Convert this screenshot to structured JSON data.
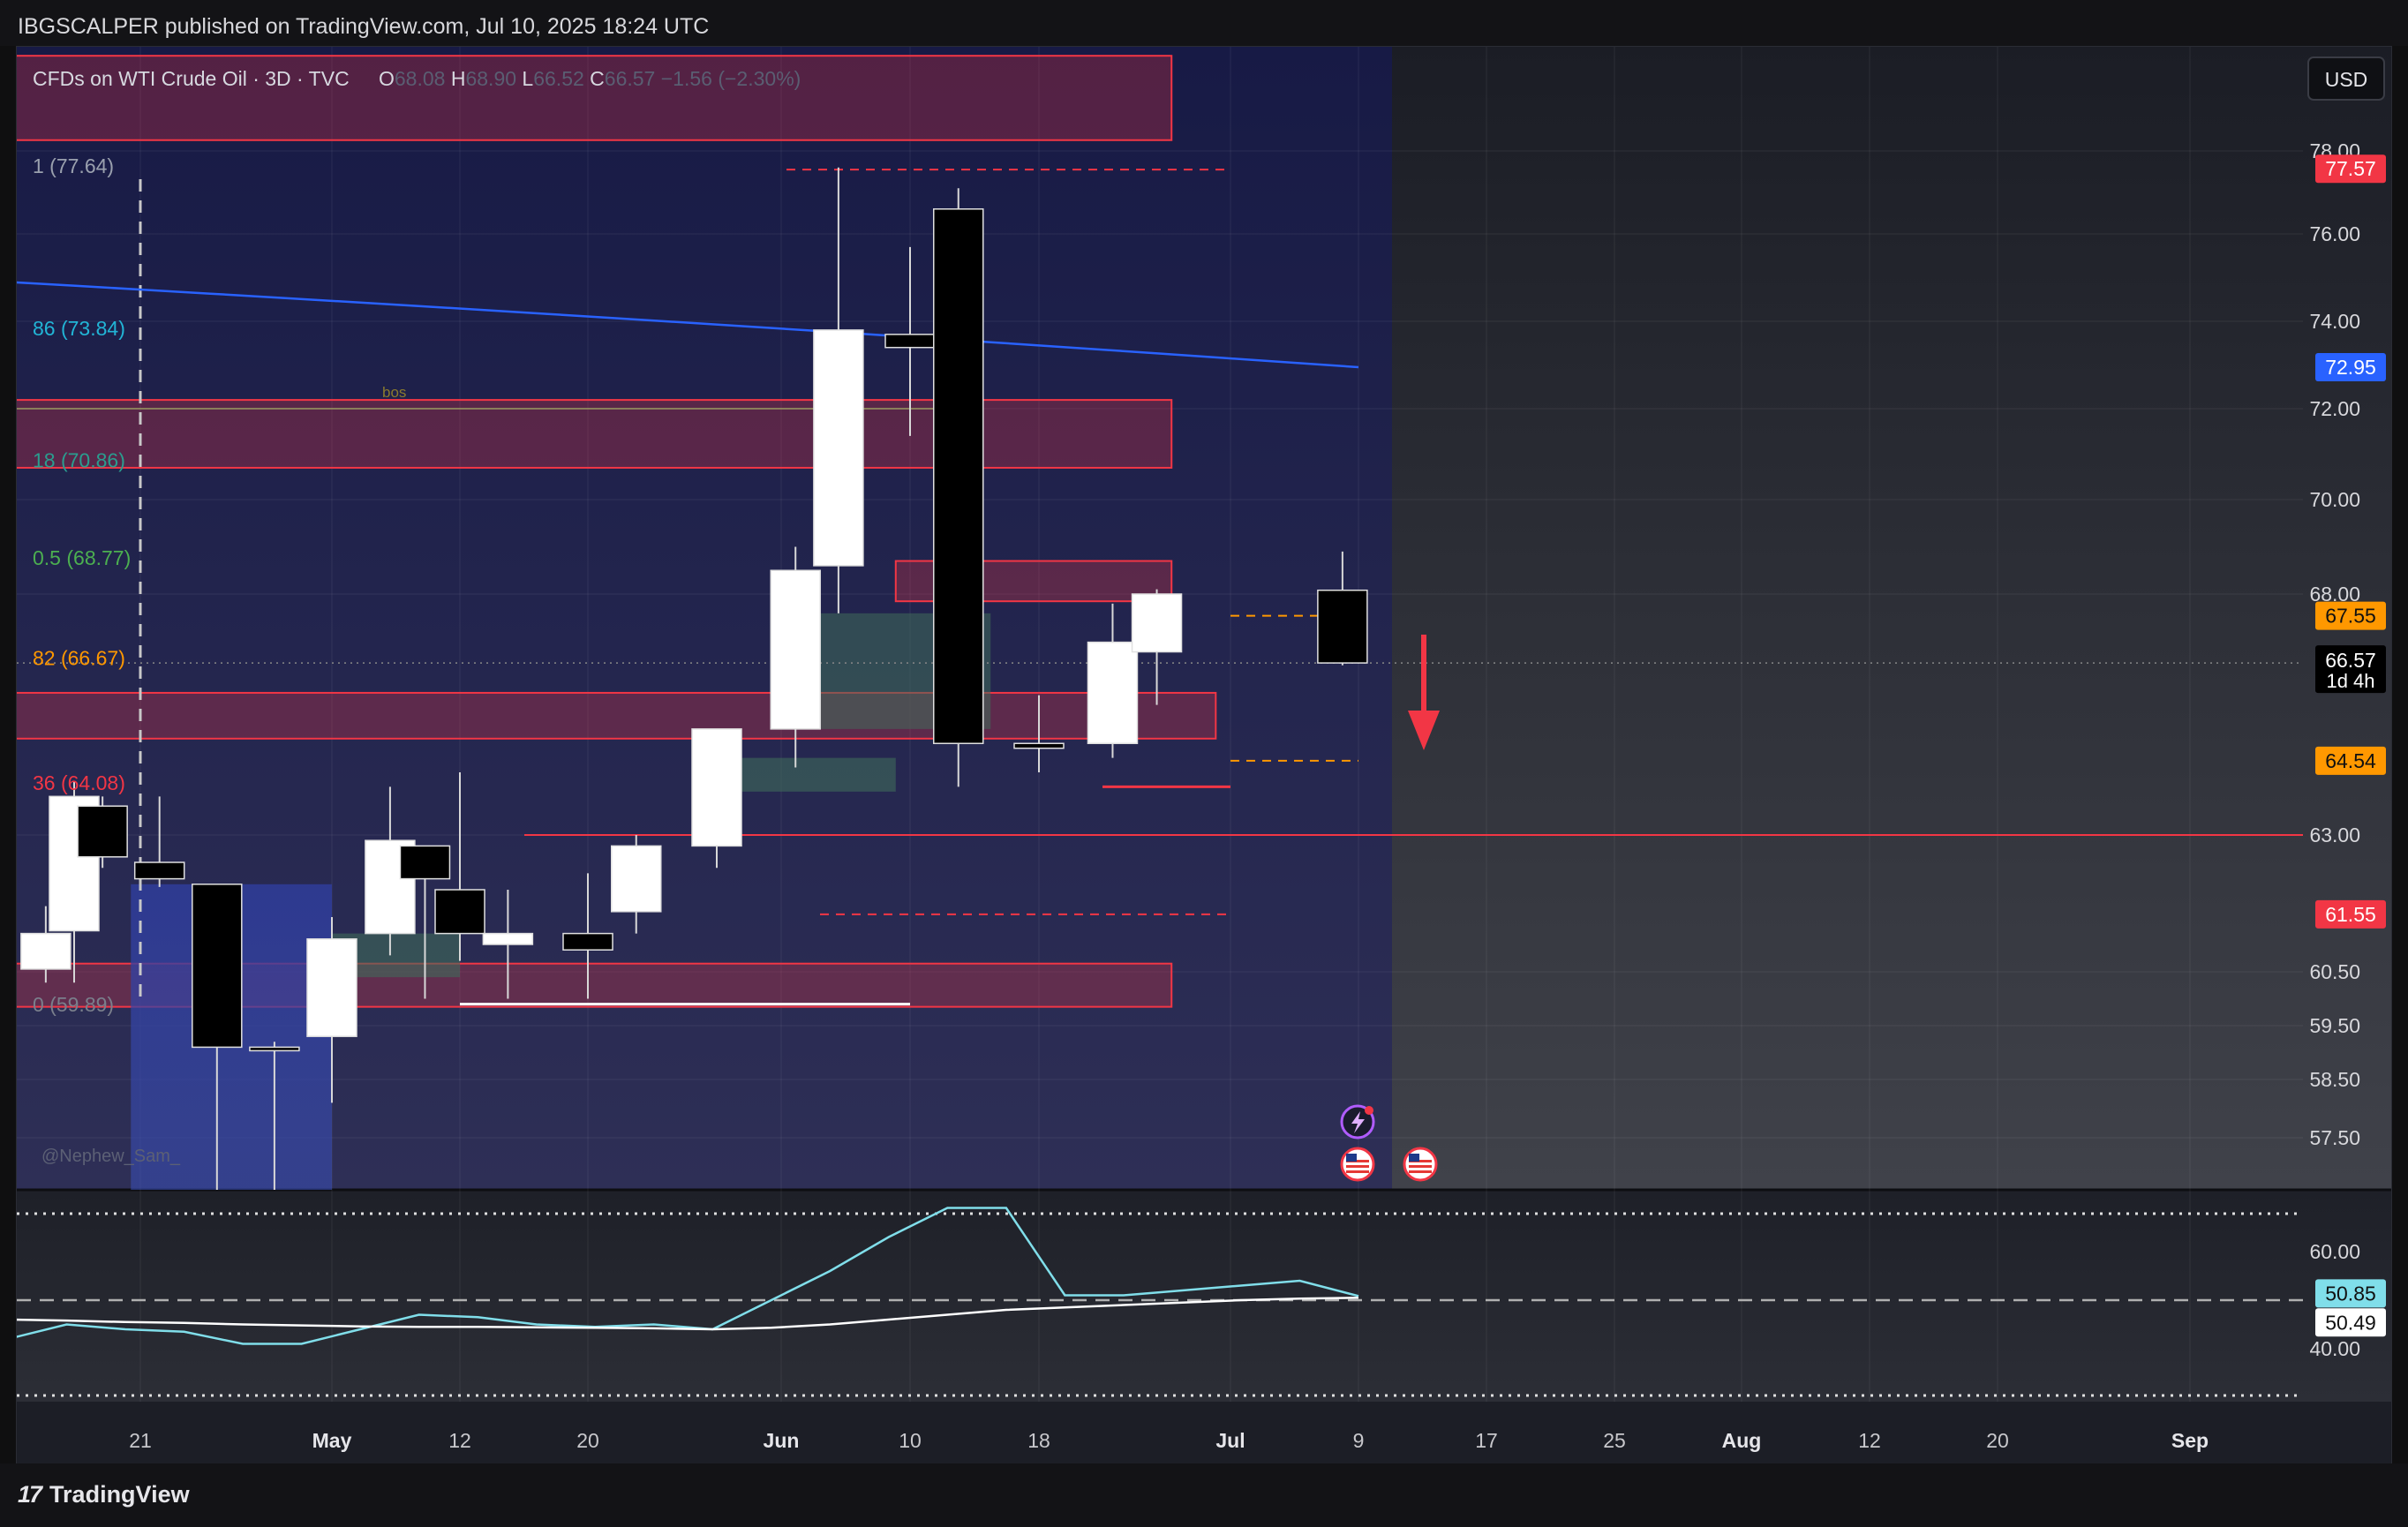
{
  "header": {
    "published": "IBGSCALPER published on TradingView.com, Jul 10, 2025 18:24 UTC"
  },
  "footer": {
    "logo_mark": "17",
    "logo_text": "TradingView"
  },
  "chart": {
    "symbol_line": "CFDs on WTI Crude Oil · 3D · TVC",
    "ohlc": [
      {
        "label": "O",
        "value": "68.08"
      },
      {
        "label": "H",
        "value": "68.90"
      },
      {
        "label": "L",
        "value": "66.52"
      },
      {
        "label": "C",
        "value": "66.57"
      },
      {
        "label": "",
        "value": "−1.56 (−2.30%)"
      }
    ],
    "currency": "USD",
    "watermark": "@Nephew_Sam_",
    "bos_label": "bos",
    "fib_labels": [
      {
        "text": "1 (77.64)",
        "price": 77.64,
        "color": "#9aa0ae"
      },
      {
        "text": "86 (73.84)",
        "price": 73.84,
        "color": "#22b5d6"
      },
      {
        "text": "18 (70.86)",
        "price": 70.86,
        "color": "#2a9d8f"
      },
      {
        "text": "0.5 (68.77)",
        "price": 68.77,
        "color": "#4caf50"
      },
      {
        "text": "82 (66.67)",
        "price": 66.67,
        "color": "#ff9800"
      },
      {
        "text": "36 (64.08)",
        "price": 64.08,
        "color": "#f23645"
      },
      {
        "text": "0 (59.89)",
        "price": 59.89,
        "color": "#7a7f8c"
      }
    ],
    "price_badges": [
      {
        "text": "77.57",
        "price": 77.57,
        "bg": "#f23645",
        "fg": "#ffffff"
      },
      {
        "text": "72.95",
        "price": 72.95,
        "bg": "#2962ff",
        "fg": "#ffffff"
      },
      {
        "text": "67.55",
        "price": 67.55,
        "bg": "#ff9800",
        "fg": "#111111"
      },
      {
        "text": "64.54",
        "price": 64.54,
        "bg": "#ff9800",
        "fg": "#111111"
      },
      {
        "text": "61.55",
        "price": 61.55,
        "bg": "#f23645",
        "fg": "#ffffff"
      }
    ],
    "last_price": {
      "price": 66.57,
      "text": "66.57",
      "countdown": "1d 4h"
    },
    "rsi_badges": [
      {
        "text": "50.85",
        "value": 50.85,
        "bg": "#80deea",
        "fg": "#111111"
      },
      {
        "text": "50.49",
        "value": 50.49,
        "bg": "#ffffff",
        "fg": "#111111"
      }
    ],
    "colors": {
      "bull": "#ffffff",
      "bull_tint": "#ffcdd2",
      "bear": "#000000",
      "zone": "#f23645",
      "ma": "#2962ff",
      "rsi": "#80deea"
    }
  },
  "chart_data": {
    "type": "candlestick",
    "symbol": "CFDs on WTI Crude Oil",
    "interval": "3D",
    "y_axis": {
      "ticks": [
        "78.00",
        "76.00",
        "74.00",
        "72.00",
        "70.00",
        "68.00",
        "63.00",
        "60.50",
        "59.50",
        "58.50",
        "57.50"
      ],
      "scale": "custom (compressed below 63)"
    },
    "x_axis": {
      "ticks": [
        {
          "label": "21",
          "date": "2025-04-21"
        },
        {
          "label": "May",
          "date": "2025-05-01"
        },
        {
          "label": "12",
          "date": "2025-05-12"
        },
        {
          "label": "20",
          "date": "2025-05-20"
        },
        {
          "label": "Jun",
          "date": "2025-06-01"
        },
        {
          "label": "10",
          "date": "2025-06-10"
        },
        {
          "label": "18",
          "date": "2025-06-18"
        },
        {
          "label": "Jul",
          "date": "2025-07-01"
        },
        {
          "label": "9",
          "date": "2025-07-09"
        },
        {
          "label": "17",
          "date": "2025-07-17"
        },
        {
          "label": "25",
          "date": "2025-07-25"
        },
        {
          "label": "Aug",
          "date": "2025-08-01"
        },
        {
          "label": "12",
          "date": "2025-08-12"
        },
        {
          "label": "20",
          "date": "2025-08-20"
        },
        {
          "label": "Sep",
          "date": "2025-09-01"
        }
      ]
    },
    "candles": [
      {
        "date": "2025-04-11",
        "o": 60.55,
        "h": 61.7,
        "l": 60.3,
        "c": 61.2
      },
      {
        "date": "2025-04-14",
        "o": 61.25,
        "h": 64.1,
        "l": 60.3,
        "c": 63.8
      },
      {
        "date": "2025-04-17",
        "o": 63.6,
        "h": 63.8,
        "l": 62.4,
        "c": 62.6
      },
      {
        "date": "2025-04-22",
        "o": 62.5,
        "h": 63.8,
        "l": 62.05,
        "c": 62.2
      },
      {
        "date": "2025-04-25",
        "o": 62.1,
        "h": 62.1,
        "l": 57.0,
        "c": 59.1
      },
      {
        "date": "2025-04-28",
        "o": 59.1,
        "h": 59.2,
        "l": 57.0,
        "c": 59.05
      },
      {
        "date": "2025-05-01",
        "o": 59.3,
        "h": 61.5,
        "l": 58.1,
        "c": 61.1
      },
      {
        "date": "2025-05-06",
        "o": 61.2,
        "h": 64.0,
        "l": 60.8,
        "c": 62.9
      },
      {
        "date": "2025-05-09",
        "o": 62.8,
        "h": 62.8,
        "l": 60.0,
        "c": 62.2
      },
      {
        "date": "2025-05-12",
        "o": 62.0,
        "h": 64.3,
        "l": 60.7,
        "c": 61.2
      },
      {
        "date": "2025-05-15",
        "o": 61.0,
        "h": 62.0,
        "l": 60.0,
        "c": 61.2
      },
      {
        "date": "2025-05-20",
        "o": 61.2,
        "h": 62.3,
        "l": 60.0,
        "c": 60.9
      },
      {
        "date": "2025-05-23",
        "o": 61.6,
        "h": 63.0,
        "l": 61.2,
        "c": 62.8
      },
      {
        "date": "2025-05-28",
        "o": 62.8,
        "h": 65.2,
        "l": 62.4,
        "c": 65.2
      },
      {
        "date": "2025-06-02",
        "o": 65.2,
        "h": 69.0,
        "l": 64.4,
        "c": 68.5
      },
      {
        "date": "2025-06-05",
        "o": 68.6,
        "h": 77.6,
        "l": 67.6,
        "c": 73.8
      },
      {
        "date": "2025-06-10",
        "o": 73.7,
        "h": 75.7,
        "l": 71.4,
        "c": 73.4
      },
      {
        "date": "2025-06-13",
        "o": 76.6,
        "h": 77.1,
        "l": 64.0,
        "c": 64.9
      },
      {
        "date": "2025-06-18",
        "o": 64.9,
        "h": 65.9,
        "l": 64.3,
        "c": 64.8
      },
      {
        "date": "2025-06-23",
        "o": 64.9,
        "h": 67.8,
        "l": 64.6,
        "c": 67.0
      },
      {
        "date": "2025-06-26",
        "o": 66.8,
        "h": 68.1,
        "l": 65.7,
        "c": 68.0
      },
      {
        "date": "2025-07-08",
        "o": 68.08,
        "h": 68.9,
        "l": 66.52,
        "c": 66.57
      }
    ],
    "moving_average": {
      "series_start": 74.9,
      "series_end": 72.95
    },
    "rsi_panel": {
      "ticks": [
        "60.00",
        "40.00"
      ],
      "rsi": [
        42,
        45,
        44,
        43.5,
        41,
        41,
        44,
        47,
        46.5,
        45,
        44.5,
        45,
        44,
        50,
        56,
        63,
        69,
        69,
        51,
        51,
        52,
        53,
        54,
        50.85
      ],
      "signal": [
        46,
        45.8,
        45.5,
        45.3,
        45,
        44.8,
        44.6,
        44.5,
        44.5,
        44.4,
        44.3,
        44.2,
        44,
        44.3,
        45,
        46,
        47,
        48,
        48.5,
        49,
        49.5,
        50,
        50.3,
        50.49
      ]
    }
  }
}
